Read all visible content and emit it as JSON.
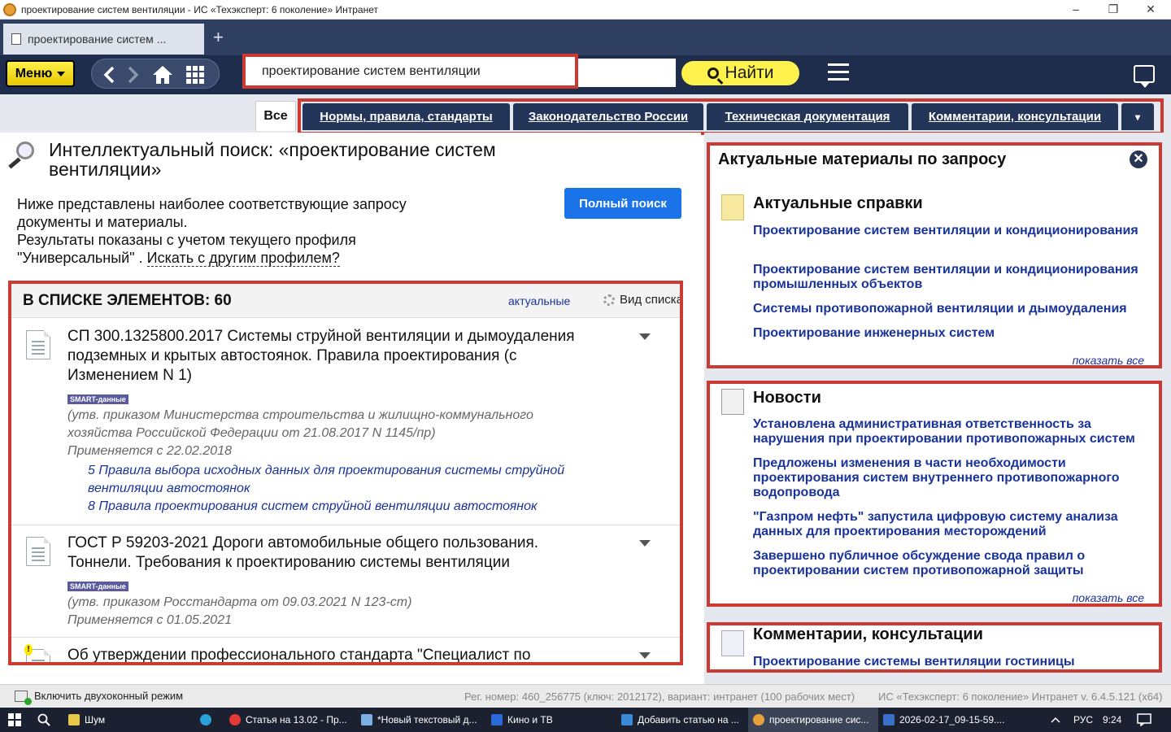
{
  "window": {
    "title": "проектирование систем вентиляции - ИС «Техэксперт: 6 поколение» Интранет",
    "minimize": "–",
    "maximize": "❐",
    "close": "✕"
  },
  "browser_tab": {
    "label": "проектирование систем ...",
    "new_tab": "+"
  },
  "toolbar": {
    "menu_label": "Меню",
    "search_value": "проектирование систем вентиляции",
    "find_label": "Найти"
  },
  "filter_tabs": {
    "all": "Все",
    "items": [
      "Нормы, правила, стандарты",
      "Законодательство России",
      "Техническая документация",
      "Комментарии, консультации"
    ],
    "more": "▾"
  },
  "intellect": {
    "title": "Интеллектуальный поиск: «проектирование систем вентиляции»",
    "desc_line1": "Ниже представлены наиболее соответствующие запросу документы и материалы.",
    "desc_line2": "Результаты показаны с учетом текущего профиля \"Универсальный\" .",
    "other_profile": "Искать с другим профилем?",
    "full_search": "Полный поиск"
  },
  "list": {
    "header": "В СПИСКЕ ЭЛЕМЕНТОВ: 60",
    "actual": "актуальные",
    "view": "Вид списка",
    "smart_label": "SMART-данные",
    "docs": [
      {
        "title": "СП 300.1325800.2017 Системы струйной вентиляции и дымоудаления подземных и крытых автостоянок. Правила проектирования (с Изменением N 1)",
        "approved": "(утв. приказом Министерства строительства и жилищно-коммунального хозяйства Российской Федерации от 21.08.2017 N 1145/пр)",
        "applies": "Применяется с 22.02.2018",
        "links": [
          "5 Правила выбора исходных данных для проектирования системы струйной вентиляции автостоянок",
          "8 Правила проектирования систем струйной вентиляции автостоянок"
        ]
      },
      {
        "title": "ГОСТ Р 59203-2021 Дороги автомобильные общего пользования. Тоннели. Требования к проектированию системы вентиляции",
        "approved": "(утв. приказом Росстандарта от 09.03.2021 N 123-ст)",
        "applies": "Применяется с 01.05.2021"
      },
      {
        "title": "Об утверждении профессионального стандарта \"Специалист по"
      }
    ]
  },
  "right": {
    "panel_title": "Актуальные материалы по запросу",
    "close": "✕",
    "refs_title": "Актуальные справки",
    "refs": [
      "Проектирование систем вентиляции и кондиционирования",
      "Проектирование систем вентиляции и кондиционирования промышленных объектов",
      "Системы противопожарной вентиляции и дымоудаления",
      "Проектирование инженерных систем"
    ],
    "show_all": "показать все",
    "news_title": "Новости",
    "news": [
      "Установлена административная ответственность за нарушения при проектировании противопожарных систем",
      "Предложены изменения в части необходимости проектирования систем внутреннего противопожарного водопровода",
      "\"Газпром нефть\" запустила цифровую систему анализа данных для проектирования месторождений",
      "Завершено публичное обсуждение свода правил о проектировании систем противопожарной защиты"
    ],
    "comments_title": "Комментарии, консультации",
    "comments": [
      "Проектирование системы вентиляции гостиницы"
    ]
  },
  "status": {
    "dual_mode": "Включить двухоконный режим",
    "reg": "Рег. номер: 460_256775 (ключ: 2012172), вариант: интранет (100 рабочих мест)",
    "version": "ИС «Техэксперт: 6 поколение» Интранет v. 6.4.5.121 (x64)"
  },
  "taskbar": {
    "items": [
      "Шум",
      "Статья на 13.02 - Пр...",
      "*Новый текстовый д...",
      "Кино и ТВ",
      "Добавить статью на ...",
      "проектирование сис...",
      "2026-02-17_09-15-59...."
    ],
    "lang": "РУС",
    "time": "9:24"
  }
}
